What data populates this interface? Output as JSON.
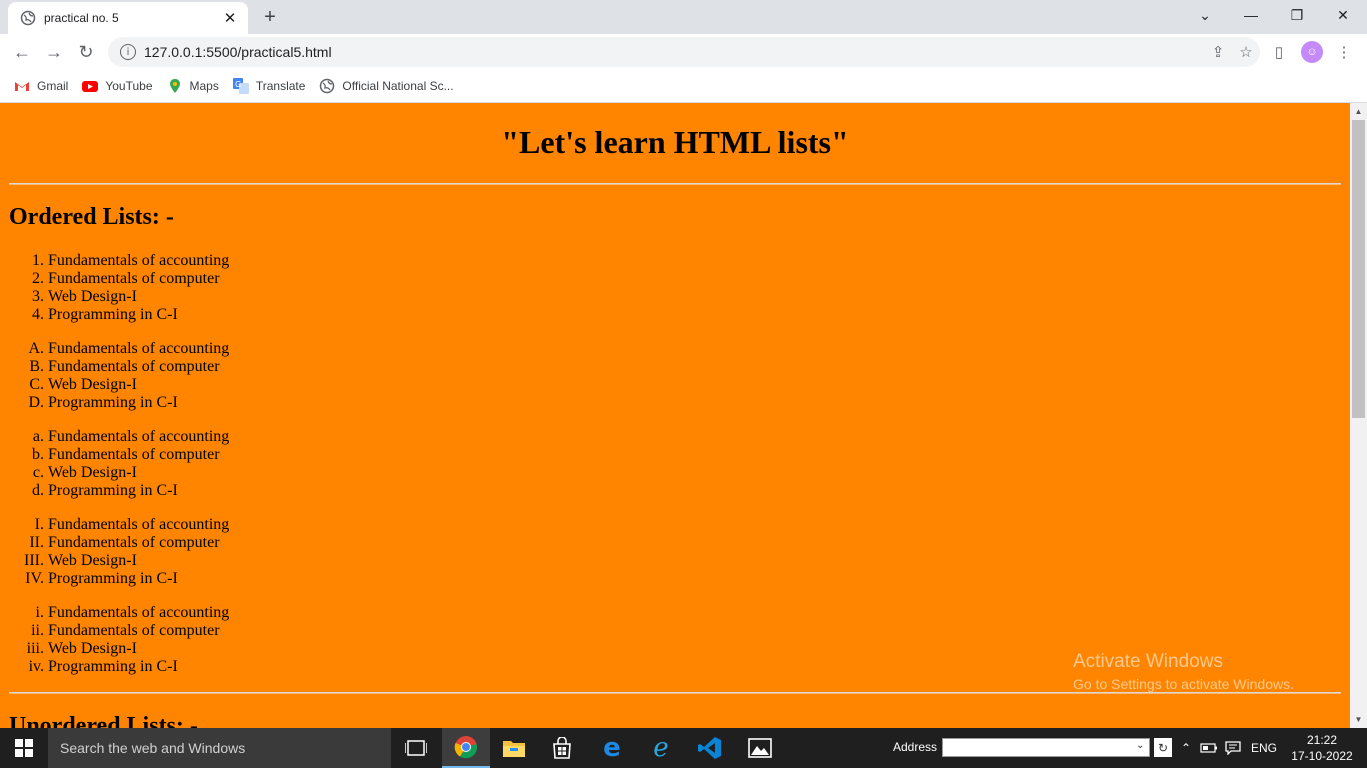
{
  "browser": {
    "tab_title": "practical no. 5",
    "url": "127.0.0.1:5500/practical5.html",
    "bookmarks": [
      {
        "label": "Gmail",
        "icon": "gmail-icon"
      },
      {
        "label": "YouTube",
        "icon": "youtube-icon"
      },
      {
        "label": "Maps",
        "icon": "maps-icon"
      },
      {
        "label": "Translate",
        "icon": "translate-icon"
      },
      {
        "label": "Official National Sc...",
        "icon": "globe-icon"
      }
    ]
  },
  "page": {
    "heading": "\"Let's learn HTML lists\"",
    "ordered_heading": "Ordered Lists: -",
    "unordered_heading": "Unordered Lists: -",
    "background": "#ff8500",
    "lists": [
      {
        "markers": [
          "1.",
          "2.",
          "3.",
          "4."
        ]
      },
      {
        "markers": [
          "A.",
          "B.",
          "C.",
          "D."
        ]
      },
      {
        "markers": [
          "a.",
          "b.",
          "c.",
          "d."
        ]
      },
      {
        "markers": [
          "I.",
          "II.",
          "III.",
          "IV."
        ]
      },
      {
        "markers": [
          "i.",
          "ii.",
          "iii.",
          "iv."
        ]
      }
    ],
    "items": [
      "Fundamentals of accounting",
      "Fundamentals of computer",
      "Web Design-I",
      "Programming in C-I"
    ]
  },
  "watermark": {
    "line1": "Activate Windows",
    "line2": "Go to Settings to activate Windows."
  },
  "taskbar": {
    "search_placeholder": "Search the web and Windows",
    "address_label": "Address",
    "language": "ENG",
    "time": "21:22",
    "date": "17-10-2022"
  }
}
